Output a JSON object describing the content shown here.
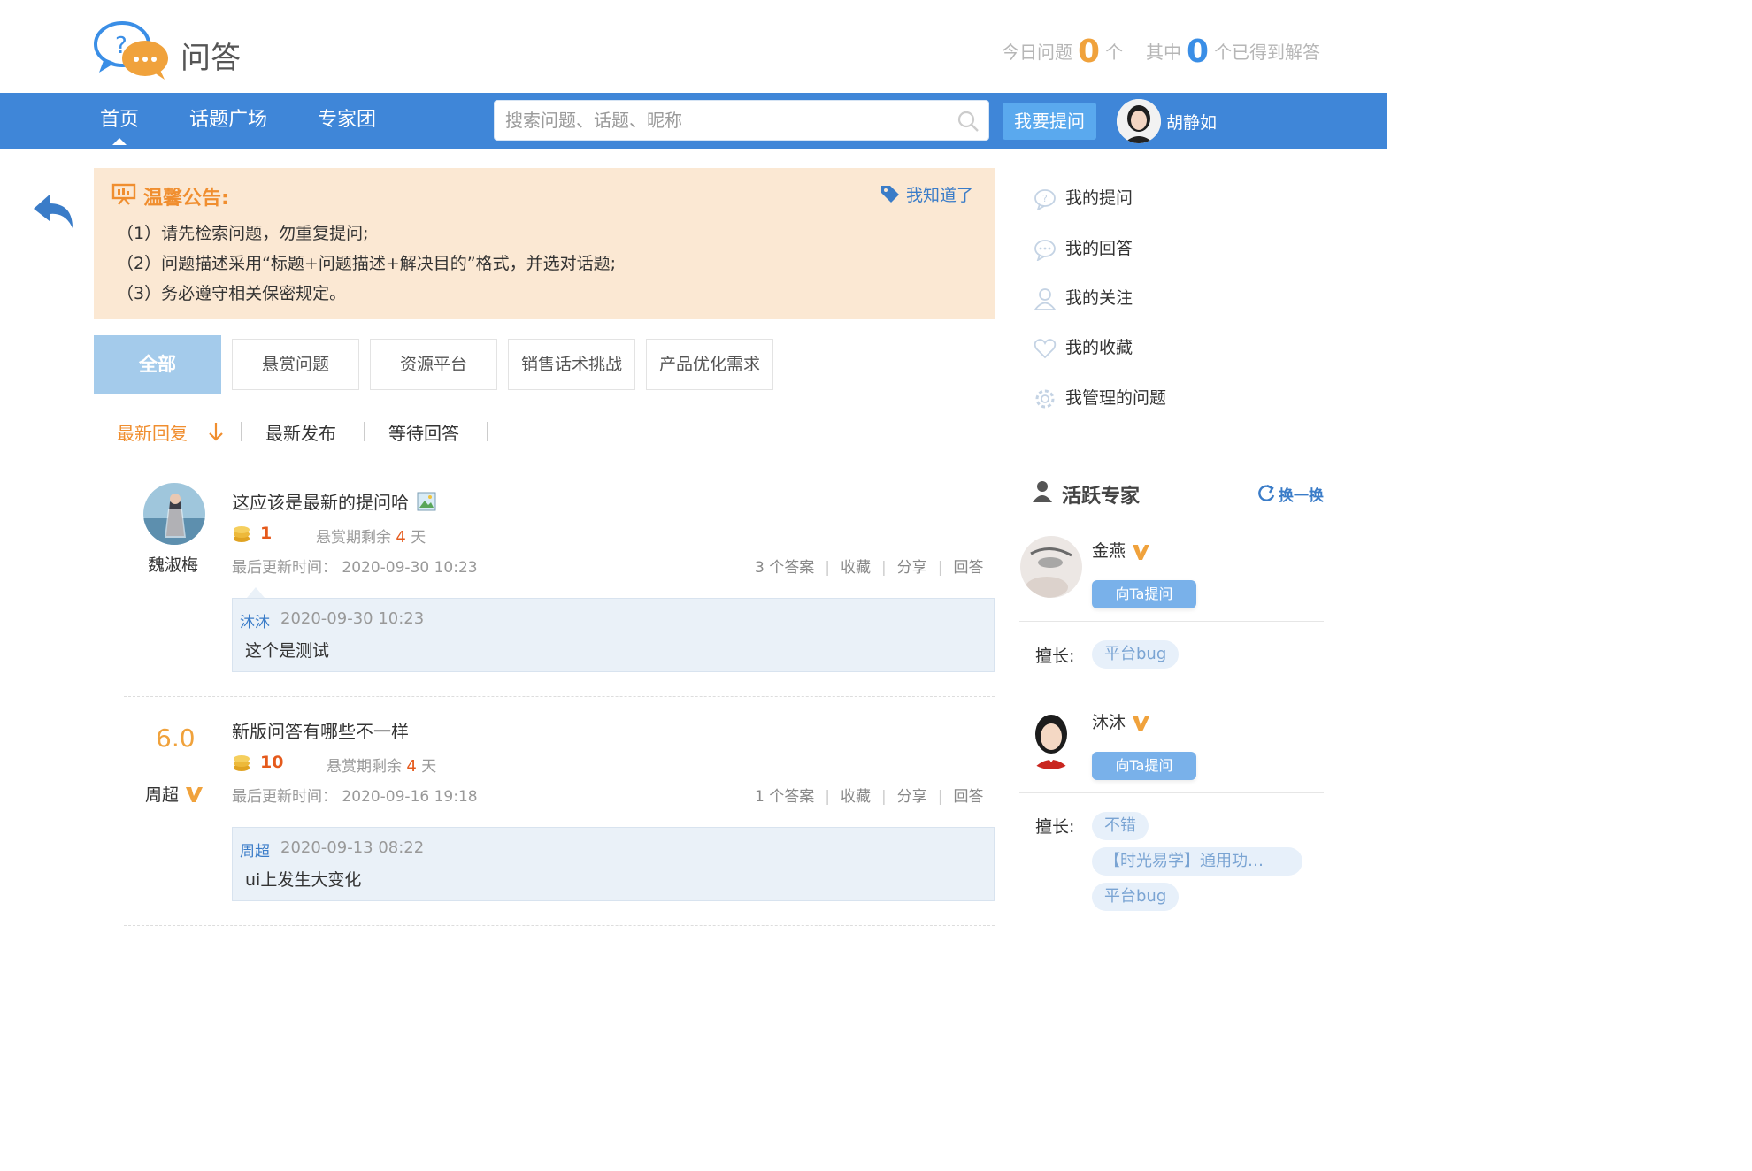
{
  "header": {
    "app_title": "问答",
    "today_label": "今日问题",
    "today_count": "0",
    "today_unit": "个",
    "solved_prefix": "其中",
    "solved_count": "0",
    "solved_suffix": "个已得到解答"
  },
  "nav": {
    "items": [
      "首页",
      "话题广场",
      "专家团"
    ],
    "search_placeholder": "搜索问题、话题、昵称",
    "ask_button": "我要提问",
    "user_name": "胡静如"
  },
  "notice": {
    "title": "温馨公告:",
    "dismiss": "我知道了",
    "lines": [
      "（1）请先检索问题，勿重复提问;",
      "（2）问题描述采用“标题+问题描述+解决目的”格式，并选对话题;",
      "（3）务必遵守相关保密规定。"
    ]
  },
  "tabs": [
    "全部",
    "悬赏问题",
    "资源平台",
    "销售话术挑战",
    "产品优化需求"
  ],
  "sort": [
    "最新回复",
    "最新发布",
    "等待回答"
  ],
  "questions": [
    {
      "author": "魏淑梅",
      "title": "这应该是最新的提问哈",
      "reward": "1",
      "remain_label": "悬赏期剩余",
      "remain_days": "4",
      "remain_unit": "天",
      "updated": "最后更新时间： 2020-09-30 10:23",
      "answers": "3 个答案",
      "favorite": "收藏",
      "share": "分享",
      "reply": "回答",
      "last_reply": {
        "name": "沐沐",
        "time": "2020-09-30 10:23",
        "text": "这个是测试"
      }
    },
    {
      "author": "周超",
      "score": "6.0",
      "title": "新版问答有哪些不一样",
      "reward": "10",
      "remain_label": "悬赏期剩余",
      "remain_days": "4",
      "remain_unit": "天",
      "updated": "最后更新时间： 2020-09-16 19:18",
      "answers": "1 个答案",
      "favorite": "收藏",
      "share": "分享",
      "reply": "回答",
      "last_reply": {
        "name": "周超",
        "time": "2020-09-13 08:22",
        "text": "ui上发生大变化"
      }
    }
  ],
  "side_menu": [
    "我的提问",
    "我的回答",
    "我的关注",
    "我的收藏",
    "我管理的问题"
  ],
  "experts": {
    "heading": "活跃专家",
    "refresh": "换一换",
    "ask_label": "向Ta提问",
    "good_at_label": "擅长:",
    "list": [
      {
        "name": "金燕",
        "tags": [
          "平台bug"
        ]
      },
      {
        "name": "沐沐",
        "tags": [
          "不错",
          "【时光易学】通用功…",
          "平台bug"
        ]
      }
    ]
  },
  "colors": {
    "nav_blue": "#3f86d8",
    "accent_orange": "#f0a23c",
    "link_blue": "#3a7cc8",
    "notice_bg": "#fbe8d3"
  }
}
